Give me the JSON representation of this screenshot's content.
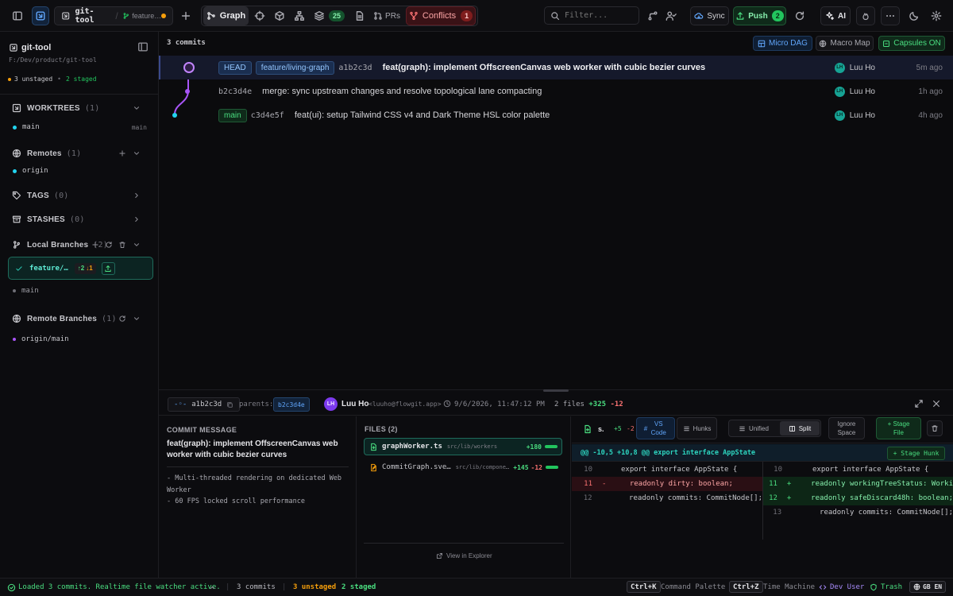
{
  "topbar": {
    "repo_tab": "git-tool",
    "branch_tab": "feature…",
    "graph_label": "Graph",
    "stack_count": "25",
    "prs_label": "PRs",
    "conflicts_label": "Conflicts",
    "conflicts_count": "1",
    "filter_placeholder": "Filter...",
    "sync_label": "Sync",
    "push_label": "Push",
    "push_count": "2",
    "ai_label": "AI"
  },
  "sidebar": {
    "repo_name": "git-tool",
    "repo_path": "F:/Dev/product/git-tool",
    "unstaged": "3 unstaged",
    "staged": "2 staged",
    "worktrees": {
      "label": "WORKTREES",
      "count": "(1)",
      "items": [
        {
          "name": "main",
          "branch": "main"
        }
      ]
    },
    "remotes": {
      "label": "Remotes",
      "count": "(1)",
      "items": [
        "origin"
      ]
    },
    "tags": {
      "label": "TAGS",
      "count": "(0)"
    },
    "stashes": {
      "label": "STASHES",
      "count": "(0)"
    },
    "local_branches": {
      "label": "Local Branches",
      "count": "(2)",
      "active": {
        "name": "feature/…",
        "ahead": "↑2",
        "behind": "↓1"
      },
      "other": "main"
    },
    "remote_branches": {
      "label": "Remote Branches",
      "count": "(1)",
      "items": [
        "origin/main"
      ]
    }
  },
  "graph": {
    "commit_count": "3 commits",
    "micro_dag": "Micro DAG",
    "macro_map": "Macro Map",
    "capsules": "Capsules ON",
    "commits": [
      {
        "tags": [
          "HEAD",
          "feature/living-graph"
        ],
        "hash": "a1b2c3d",
        "message": "feat(graph): implement OffscreenCanvas web worker with cubic bezier curves",
        "initials": "LH",
        "author": "Luu Ho",
        "time": "5m ago"
      },
      {
        "tags": [],
        "hash": "b2c3d4e",
        "message": "merge: sync upstream changes and resolve topological lane compacting",
        "initials": "LH",
        "author": "Luu Ho",
        "time": "1h ago"
      },
      {
        "tags": [
          "main"
        ],
        "hash": "c3d4e5f",
        "message": "feat(ui): setup Tailwind CSS v4 and Dark Theme HSL color palette",
        "initials": "LH",
        "author": "Luu Ho",
        "time": "4h ago"
      }
    ]
  },
  "detail": {
    "hash": "a1b2c3d",
    "parents_label": "parents:",
    "parent": "b2c3d4e",
    "initials": "LH",
    "author": "Luu Ho",
    "email": "<luuho@flowgit.app>",
    "date": "9/6/2026, 11:47:12 PM",
    "files_count": "2 files",
    "additions": "+325",
    "deletions": "-12",
    "commit_message_label": "COMMIT MESSAGE",
    "subject": "feat(graph): implement OffscreenCanvas web worker with cubic bezier curves",
    "body": [
      "- Multi-threaded rendering on dedicated Web Worker",
      "- 60 FPS locked scroll performance"
    ],
    "files_label": "FILES (2)",
    "files": [
      {
        "name": "graphWorker.ts",
        "path": "src/lib/workers",
        "add": "+180",
        "del": ""
      },
      {
        "name": "CommitGraph.sve…",
        "path": "src/lib/compone…",
        "add": "+145",
        "del": "-12"
      }
    ],
    "view_in_explorer": "View in Explorer",
    "diff": {
      "file_short": "s.",
      "add": "+5",
      "del": "-2",
      "vscode": "VS Code",
      "hunks": "Hunks",
      "unified": "Unified",
      "split": "Split",
      "ignore_space": "Ignore Space",
      "stage_file": "+ Stage File",
      "hunk_header": "@@ -10,5 +10,8 @@ export interface AppState",
      "stage_hunk": "+ Stage Hunk",
      "left": [
        {
          "n": "10",
          "sign": "",
          "text": "export interface AppState {"
        },
        {
          "n": "11",
          "sign": "-",
          "text": "  readonly dirty: boolean;"
        },
        {
          "n": "12",
          "sign": "",
          "text": "  readonly commits: CommitNode[];"
        }
      ],
      "right": [
        {
          "n": "10",
          "sign": "",
          "text": "export interface AppState {"
        },
        {
          "n": "11",
          "sign": "+",
          "text": "  readonly workingTreeStatus: Worki"
        },
        {
          "n": "12",
          "sign": "+",
          "text": "  readonly safeDiscard48h: boolean;"
        },
        {
          "n": "13",
          "sign": "",
          "text": "  readonly commits: CommitNode[];"
        }
      ]
    }
  },
  "statusbar": {
    "message": "Loaded 3 commits. Realtime file watcher active.",
    "commits": "3 commits",
    "unstaged": "3 unstaged",
    "staged": "2 staged",
    "kbd1": "Ctrl+K",
    "kbd1_label": "Command Palette",
    "kbd2": "Ctrl+Z",
    "kbd2_label": "Time Machine",
    "dev_user": "Dev User",
    "trash": "Trash",
    "lang": "GB EN"
  },
  "colors": {
    "accent": "#a855f7",
    "green": "#22c55e",
    "teal": "#2dd4bf",
    "cyan": "#22d3ee",
    "red": "#ef4444",
    "orange": "#f59e0b"
  }
}
